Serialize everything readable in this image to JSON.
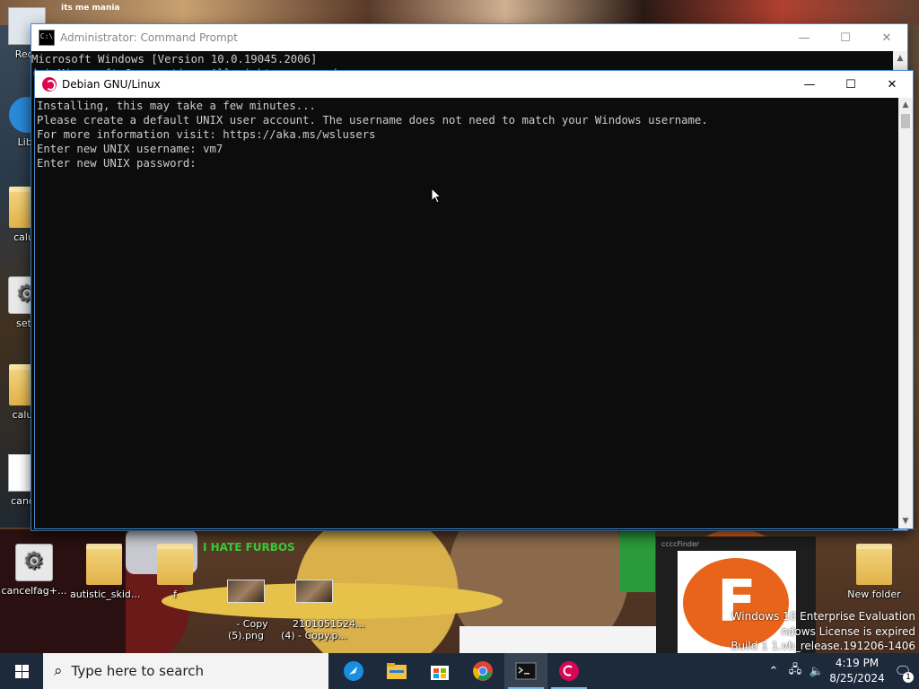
{
  "desktop": {
    "top_text": "its me mania",
    "banner_text": "I HATE FURBOS",
    "left_icons": [
      "Recy",
      "Libr",
      "calub",
      "setu",
      "calubj",
      "cancel"
    ],
    "bottom_icons": [
      {
        "label": "cancelfag+...",
        "icon": "gear-icon"
      },
      {
        "label": "autistic_skid...",
        "icon": "file-icon"
      },
      {
        "label": "f",
        "icon": "folder-icon"
      },
      {
        "label": "- Copy\n(5).png",
        "icon": "image-icon"
      },
      {
        "label": "2101051524...\n(4) - Copy.p...",
        "icon": "image-icon"
      },
      {
        "label": "New folder",
        "icon": "folder-icon"
      }
    ],
    "watermark": {
      "line1": "Windows 10 Enterprise Evaluation",
      "line2": "ndows License is expired",
      "line3": "Build 1 1.vb_release.191206-1406"
    }
  },
  "cmd_window": {
    "title": "Administrator: Command Prompt",
    "line1": "Microsoft Windows [Version 10.0.19045.2006]",
    "line2": "(c) Microsoft Corporation. All rights reserved."
  },
  "debian_window": {
    "title": "Debian GNU/Linux",
    "lines": [
      "Installing, this may take a few minutes...",
      "Please create a default UNIX user account. The username does not need to match your Windows username.",
      "For more information visit: https://aka.ms/wslusers",
      "Enter new UNIX username: vm7",
      "Enter new UNIX password:"
    ]
  },
  "controls": {
    "minimize": "—",
    "maximize": "☐",
    "close": "✕"
  },
  "mini_window": {
    "title": "ccccFinder",
    "logo_letter": "F"
  },
  "taskbar": {
    "search_placeholder": "Type here to search",
    "apps": [
      "browser-icon",
      "file-explorer-icon",
      "store-icon",
      "chrome-icon",
      "terminal-icon",
      "debian-icon"
    ],
    "time": "4:19 PM",
    "date": "8/25/2024",
    "notification_count": "1"
  },
  "colors": {
    "terminal_bg": "#0c0c0c",
    "terminal_fg": "#cccccc",
    "taskbar_bg": "#1c2a3c",
    "debian_red": "#d70751"
  }
}
